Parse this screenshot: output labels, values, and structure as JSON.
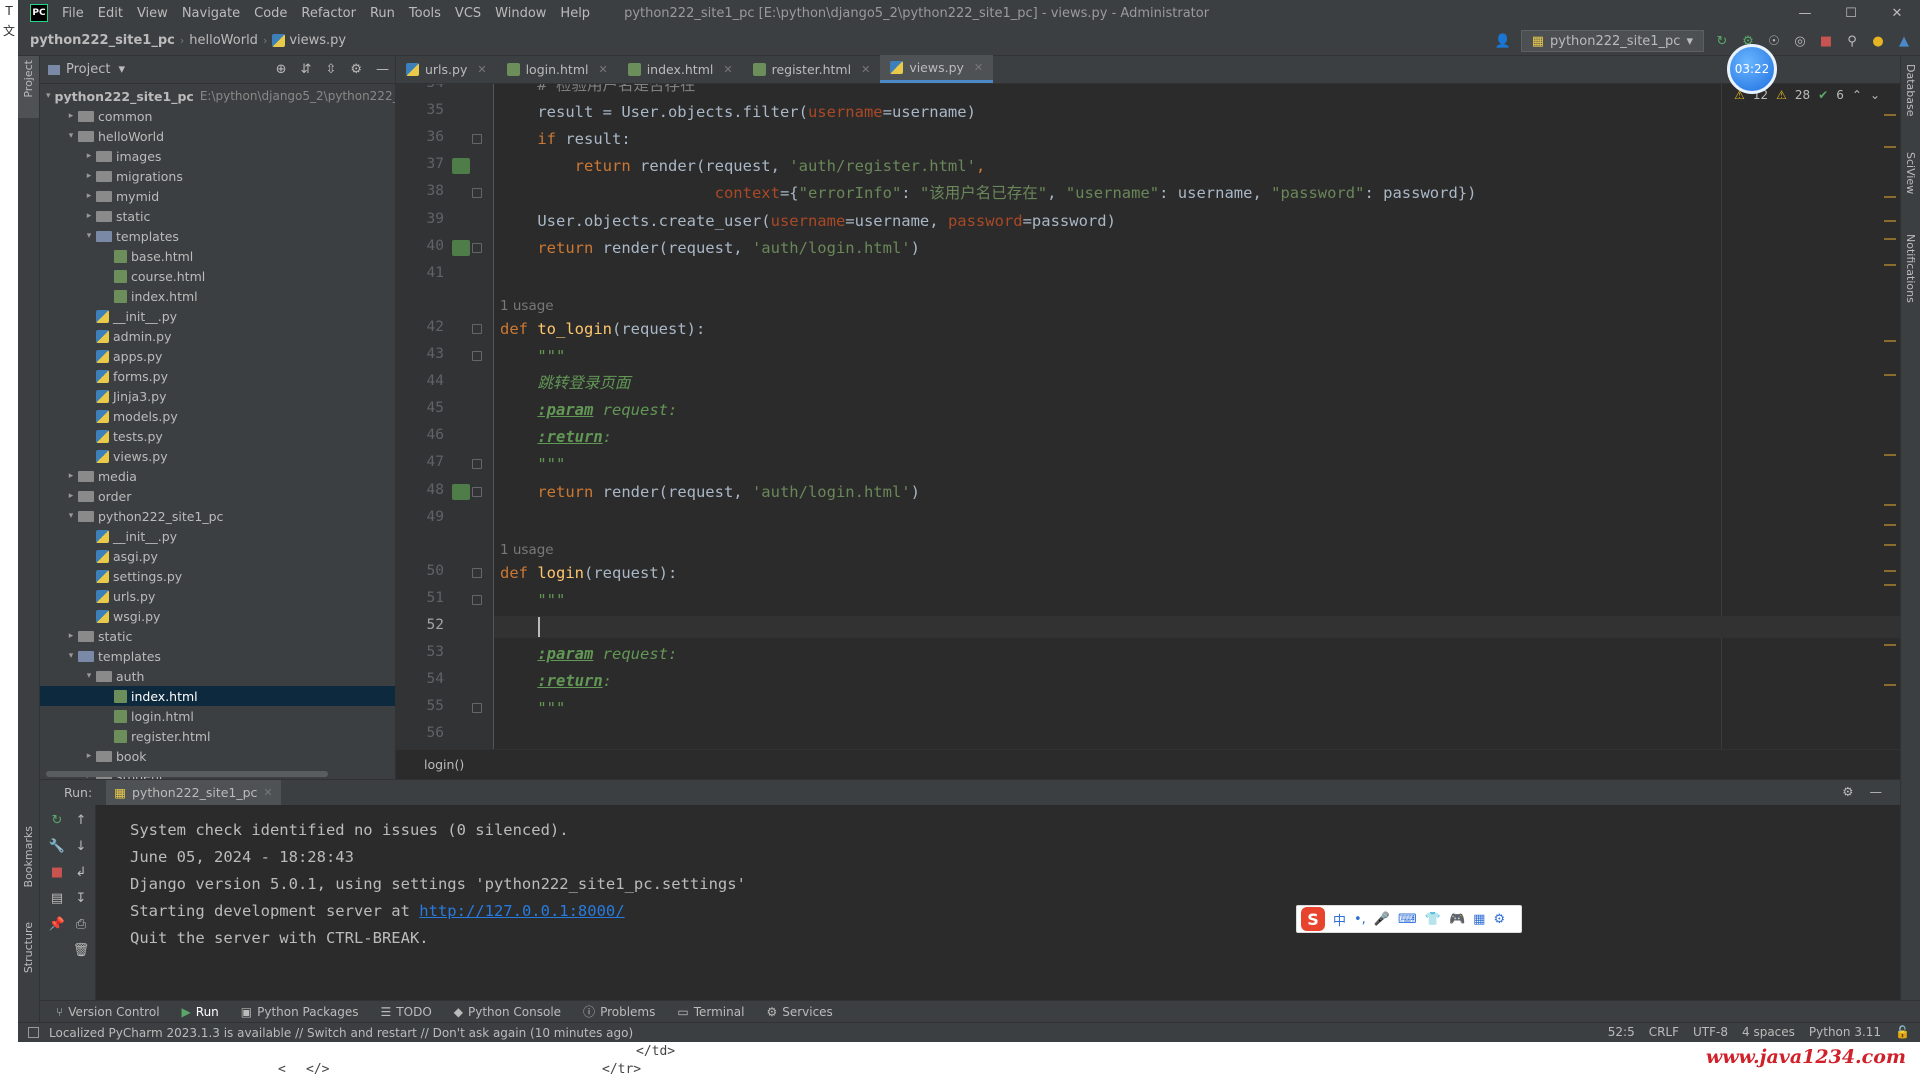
{
  "desktop": {
    "gutter_glyphs": [
      "T",
      "文"
    ]
  },
  "titlebar": {
    "logo": "PC",
    "menu": [
      "File",
      "Edit",
      "View",
      "Navigate",
      "Code",
      "Refactor",
      "Run",
      "Tools",
      "VCS",
      "Window",
      "Help"
    ],
    "window_title": "python222_site1_pc [E:\\python\\django5_2\\python222_site1_pc] - views.py - Administrator"
  },
  "navbar": {
    "crumbs": [
      "python222_site1_pc",
      "helloWorld",
      "views.py"
    ],
    "run_config": "python222_site1_pc"
  },
  "left_stripe": {
    "labels": [
      "Project",
      "Bookmarks",
      "Structure"
    ]
  },
  "right_stripe": {
    "labels": [
      "Database",
      "SciView",
      "Notifications"
    ]
  },
  "project_panel": {
    "title": "Project",
    "root_path": "E:\\python\\django5_2\\python222_",
    "tree": [
      {
        "label": "python222_site1_pc",
        "type": "folder",
        "depth": 0,
        "expanded": true,
        "bold": true
      },
      {
        "label": "common",
        "type": "folder",
        "depth": 1,
        "expanded": false
      },
      {
        "label": "helloWorld",
        "type": "folder",
        "depth": 1,
        "expanded": true
      },
      {
        "label": "images",
        "type": "folder",
        "depth": 2,
        "expanded": false
      },
      {
        "label": "migrations",
        "type": "folder",
        "depth": 2,
        "expanded": false
      },
      {
        "label": "mymid",
        "type": "folder",
        "depth": 2,
        "expanded": false
      },
      {
        "label": "static",
        "type": "folder",
        "depth": 2,
        "expanded": false
      },
      {
        "label": "templates",
        "type": "folder",
        "depth": 2,
        "expanded": true
      },
      {
        "label": "base.html",
        "type": "html",
        "depth": 3
      },
      {
        "label": "course.html",
        "type": "html",
        "depth": 3
      },
      {
        "label": "index.html",
        "type": "html",
        "depth": 3
      },
      {
        "label": "__init__.py",
        "type": "py",
        "depth": 2
      },
      {
        "label": "admin.py",
        "type": "py",
        "depth": 2
      },
      {
        "label": "apps.py",
        "type": "py",
        "depth": 2
      },
      {
        "label": "forms.py",
        "type": "py",
        "depth": 2
      },
      {
        "label": "Jinja3.py",
        "type": "py",
        "depth": 2
      },
      {
        "label": "models.py",
        "type": "py",
        "depth": 2
      },
      {
        "label": "tests.py",
        "type": "py",
        "depth": 2
      },
      {
        "label": "views.py",
        "type": "py",
        "depth": 2
      },
      {
        "label": "media",
        "type": "folder",
        "depth": 1,
        "expanded": false
      },
      {
        "label": "order",
        "type": "folder",
        "depth": 1,
        "expanded": false
      },
      {
        "label": "python222_site1_pc",
        "type": "folder",
        "depth": 1,
        "expanded": true
      },
      {
        "label": "__init__.py",
        "type": "py",
        "depth": 2
      },
      {
        "label": "asgi.py",
        "type": "py",
        "depth": 2
      },
      {
        "label": "settings.py",
        "type": "py",
        "depth": 2
      },
      {
        "label": "urls.py",
        "type": "py",
        "depth": 2
      },
      {
        "label": "wsgi.py",
        "type": "py",
        "depth": 2
      },
      {
        "label": "static",
        "type": "folder",
        "depth": 1,
        "expanded": false
      },
      {
        "label": "templates",
        "type": "folder",
        "depth": 1,
        "expanded": true
      },
      {
        "label": "auth",
        "type": "folder",
        "depth": 2,
        "expanded": true
      },
      {
        "label": "index.html",
        "type": "html",
        "depth": 3,
        "selected": true
      },
      {
        "label": "login.html",
        "type": "html",
        "depth": 3
      },
      {
        "label": "register.html",
        "type": "html",
        "depth": 3
      },
      {
        "label": "book",
        "type": "folder",
        "depth": 2,
        "expanded": false
      },
      {
        "label": "student",
        "type": "folder",
        "depth": 2,
        "expanded": false
      }
    ]
  },
  "editor_tabs": [
    {
      "label": "urls.py",
      "type": "py",
      "active": false
    },
    {
      "label": "login.html",
      "type": "html",
      "active": false
    },
    {
      "label": "index.html",
      "type": "html",
      "active": false
    },
    {
      "label": "register.html",
      "type": "html",
      "active": false
    },
    {
      "label": "views.py",
      "type": "py",
      "active": true
    }
  ],
  "inspections": {
    "warnings": "12",
    "weak_warnings": "28",
    "ok": "6"
  },
  "editor": {
    "current_line": 52,
    "lines": [
      {
        "n": "34",
        "partial": true,
        "tokens": [
          [
            "    # 检验用户名是否存在",
            "com"
          ]
        ]
      },
      {
        "n": "35",
        "tokens": [
          [
            "    result = User.objects.filter(",
            "t"
          ],
          [
            "username",
            "prm"
          ],
          [
            "=username)",
            "t"
          ]
        ]
      },
      {
        "n": "36",
        "tokens": [
          [
            "    ",
            "t"
          ],
          [
            "if",
            "kw"
          ],
          [
            " result:",
            "t"
          ]
        ]
      },
      {
        "n": "37",
        "tokens": [
          [
            "        ",
            "t"
          ],
          [
            "return",
            "kw"
          ],
          [
            " render(request, ",
            "t"
          ],
          [
            "'auth/register.html'",
            "str"
          ],
          [
            ",",
            "kw"
          ]
        ]
      },
      {
        "n": "38",
        "tokens": [
          [
            "                       ",
            "t"
          ],
          [
            "context",
            "prm"
          ],
          [
            "={",
            "t"
          ],
          [
            "\"errorInfo\"",
            "str"
          ],
          [
            ": ",
            "t"
          ],
          [
            "\"该用户名已存在\"",
            "str"
          ],
          [
            ", ",
            "t"
          ],
          [
            "\"username\"",
            "str"
          ],
          [
            ": username, ",
            "t"
          ],
          [
            "\"password\"",
            "str"
          ],
          [
            ": password})",
            "t"
          ]
        ]
      },
      {
        "n": "39",
        "tokens": [
          [
            "    User.objects.create_user(",
            "t"
          ],
          [
            "username",
            "prm"
          ],
          [
            "=username, ",
            "t"
          ],
          [
            "password",
            "prm"
          ],
          [
            "=password)",
            "t"
          ]
        ]
      },
      {
        "n": "40",
        "tokens": [
          [
            "    ",
            "t"
          ],
          [
            "return",
            "kw"
          ],
          [
            " render(request, ",
            "t"
          ],
          [
            "'auth/login.html'",
            "str"
          ],
          [
            ")",
            "t"
          ]
        ]
      },
      {
        "n": "41",
        "tokens": []
      },
      {
        "n": "",
        "usage": "1 usage"
      },
      {
        "n": "42",
        "tokens": [
          [
            "def",
            "kw"
          ],
          [
            " ",
            "t"
          ],
          [
            "to_login",
            "fn"
          ],
          [
            "(request):",
            "t"
          ]
        ]
      },
      {
        "n": "43",
        "tokens": [
          [
            "    \"\"\"",
            "doc"
          ]
        ]
      },
      {
        "n": "44",
        "tokens": [
          [
            "    跳转登录页面",
            "doc"
          ]
        ]
      },
      {
        "n": "45",
        "tokens": [
          [
            "    ",
            "doc"
          ],
          [
            ":param",
            "doctag"
          ],
          [
            " request:",
            "doc"
          ]
        ]
      },
      {
        "n": "46",
        "tokens": [
          [
            "    ",
            "doc"
          ],
          [
            ":return",
            "doctag"
          ],
          [
            ":",
            "doc"
          ]
        ]
      },
      {
        "n": "47",
        "tokens": [
          [
            "    \"\"\"",
            "doc"
          ]
        ]
      },
      {
        "n": "48",
        "tokens": [
          [
            "    ",
            "t"
          ],
          [
            "return",
            "kw"
          ],
          [
            " render(request, ",
            "t"
          ],
          [
            "'auth/login.html'",
            "str"
          ],
          [
            ")",
            "t"
          ]
        ]
      },
      {
        "n": "49",
        "tokens": []
      },
      {
        "n": "",
        "usage": "1 usage"
      },
      {
        "n": "50",
        "tokens": [
          [
            "def",
            "kw"
          ],
          [
            " ",
            "t"
          ],
          [
            "login",
            "fn"
          ],
          [
            "(request):",
            "t"
          ]
        ]
      },
      {
        "n": "51",
        "tokens": [
          [
            "    \"\"\"",
            "doc"
          ]
        ]
      },
      {
        "n": "52",
        "tokens": [
          [
            "    ",
            "t"
          ]
        ]
      },
      {
        "n": "53",
        "tokens": [
          [
            "    ",
            "doc"
          ],
          [
            ":param",
            "doctag"
          ],
          [
            " request:",
            "doc"
          ]
        ]
      },
      {
        "n": "54",
        "tokens": [
          [
            "    ",
            "doc"
          ],
          [
            ":return",
            "doctag"
          ],
          [
            ":",
            "doc"
          ]
        ]
      },
      {
        "n": "55",
        "tokens": [
          [
            "    \"\"\"",
            "doc"
          ]
        ]
      },
      {
        "n": "56",
        "tokens": []
      }
    ]
  },
  "editor_breadcrumb": "login()",
  "run_panel": {
    "label": "Run:",
    "tab": "python222_site1_pc",
    "console": [
      {
        "text": "System check identified no issues (0 silenced)."
      },
      {
        "text": "June 05, 2024 - 18:28:43"
      },
      {
        "text": "Django version 5.0.1, using settings 'python222_site1_pc.settings'"
      },
      {
        "text": "Starting development server at ",
        "link": "http://127.0.0.1:8000/"
      },
      {
        "text": "Quit the server with CTRL-BREAK."
      }
    ]
  },
  "ime_toolbar": {
    "logo": "S",
    "items": [
      "中",
      "•,",
      "🎤",
      "⌨",
      "👕",
      "🎮",
      "▦",
      "⚙"
    ]
  },
  "bottom_tabs": [
    {
      "label": "Version Control",
      "icon": "branch-icon"
    },
    {
      "label": "Run",
      "icon": "play-icon",
      "active": true
    },
    {
      "label": "Python Packages",
      "icon": "package-icon"
    },
    {
      "label": "TODO",
      "icon": "list-icon"
    },
    {
      "label": "Python Console",
      "icon": "console-icon"
    },
    {
      "label": "Problems",
      "icon": "problems-icon"
    },
    {
      "label": "Terminal",
      "icon": "terminal-icon"
    },
    {
      "label": "Services",
      "icon": "services-icon"
    }
  ],
  "statusbar": {
    "message": "Localized PyCharm 2023.1.3 is available // Switch and restart // Don't ask again (10 minutes ago)",
    "position": "52:5",
    "line_sep": "CRLF",
    "encoding": "UTF-8",
    "indent": "4 spaces",
    "interpreter": "Python 3.11"
  },
  "below_window": {
    "code_lines": [
      "</td>",
      "</tr>"
    ],
    "nav": [
      "<",
      "</>"
    ],
    "watermark": "www.java1234.com"
  },
  "timer": "03:22",
  "colors": {
    "accent": "#4a88c7",
    "bg": "#2b2b2b",
    "panel": "#3c3f41",
    "keyword": "#cc7832",
    "string": "#6a8759",
    "param": "#aa4926",
    "function": "#ffc66d",
    "docstring": "#629755",
    "link": "#287bde",
    "watermark": "#d0202a"
  }
}
